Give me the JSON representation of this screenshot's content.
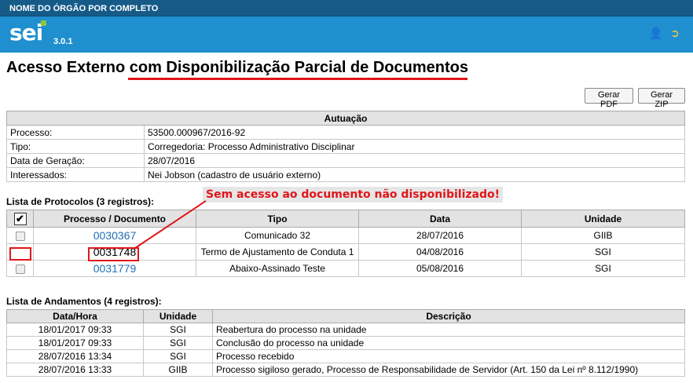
{
  "topbar": {
    "org_name": "NOME DO ÓRGÃO POR COMPLETO"
  },
  "header": {
    "logo": "sei",
    "version": "3.0.1"
  },
  "page": {
    "title": "Acesso Externo com Disponibilização Parcial de Documentos"
  },
  "buttons": {
    "pdf": "Gerar PDF",
    "zip": "Gerar ZIP"
  },
  "autuacao": {
    "header": "Autuação",
    "rows": [
      {
        "label": "Processo:",
        "value": "53500.000967/2016-92"
      },
      {
        "label": "Tipo:",
        "value": "Corregedoria: Processo Administrativo Disciplinar"
      },
      {
        "label": "Data de Geração:",
        "value": "28/07/2016"
      },
      {
        "label": "Interessados:",
        "value": "Nei Jobson (cadastro de usuário externo)"
      }
    ]
  },
  "protocolos": {
    "label": "Lista de Protocolos (3 registros):",
    "columns": [
      "Processo / Documento",
      "Tipo",
      "Data",
      "Unidade"
    ],
    "rows": [
      {
        "doc": "0030367",
        "tipo": "Comunicado 32",
        "data": "28/07/2016",
        "unidade": "GIIB"
      },
      {
        "doc": "0031748",
        "tipo": "Termo de Ajustamento de Conduta 1",
        "data": "04/08/2016",
        "unidade": "SGI"
      },
      {
        "doc": "0031779",
        "tipo": "Abaixo-Assinado Teste",
        "data": "05/08/2016",
        "unidade": "SGI"
      }
    ]
  },
  "andamentos": {
    "label": "Lista de Andamentos (4 registros):",
    "columns": [
      "Data/Hora",
      "Unidade",
      "Descrição"
    ],
    "rows": [
      {
        "datahora": "18/01/2017 09:33",
        "unidade": "SGI",
        "descricao": "Reabertura do processo na unidade"
      },
      {
        "datahora": "18/01/2017 09:33",
        "unidade": "SGI",
        "descricao": "Conclusão do processo na unidade"
      },
      {
        "datahora": "28/07/2016 13:34",
        "unidade": "SGI",
        "descricao": "Processo recebido"
      },
      {
        "datahora": "28/07/2016 13:33",
        "unidade": "GIIB",
        "descricao": "Processo sigiloso gerado, Processo de Responsabilidade de Servidor (Art. 150 da Lei nº 8.112/1990)"
      }
    ]
  },
  "annotation": {
    "text": "Sem acesso ao documento não disponibilizado!"
  },
  "colors": {
    "header_blue": "#1f8fcf",
    "topbar_blue": "#165b88",
    "link": "#1f6fb5",
    "annotation_red": "#e0161b"
  },
  "icons": {
    "user": "user-icon",
    "exit": "exit-icon"
  }
}
